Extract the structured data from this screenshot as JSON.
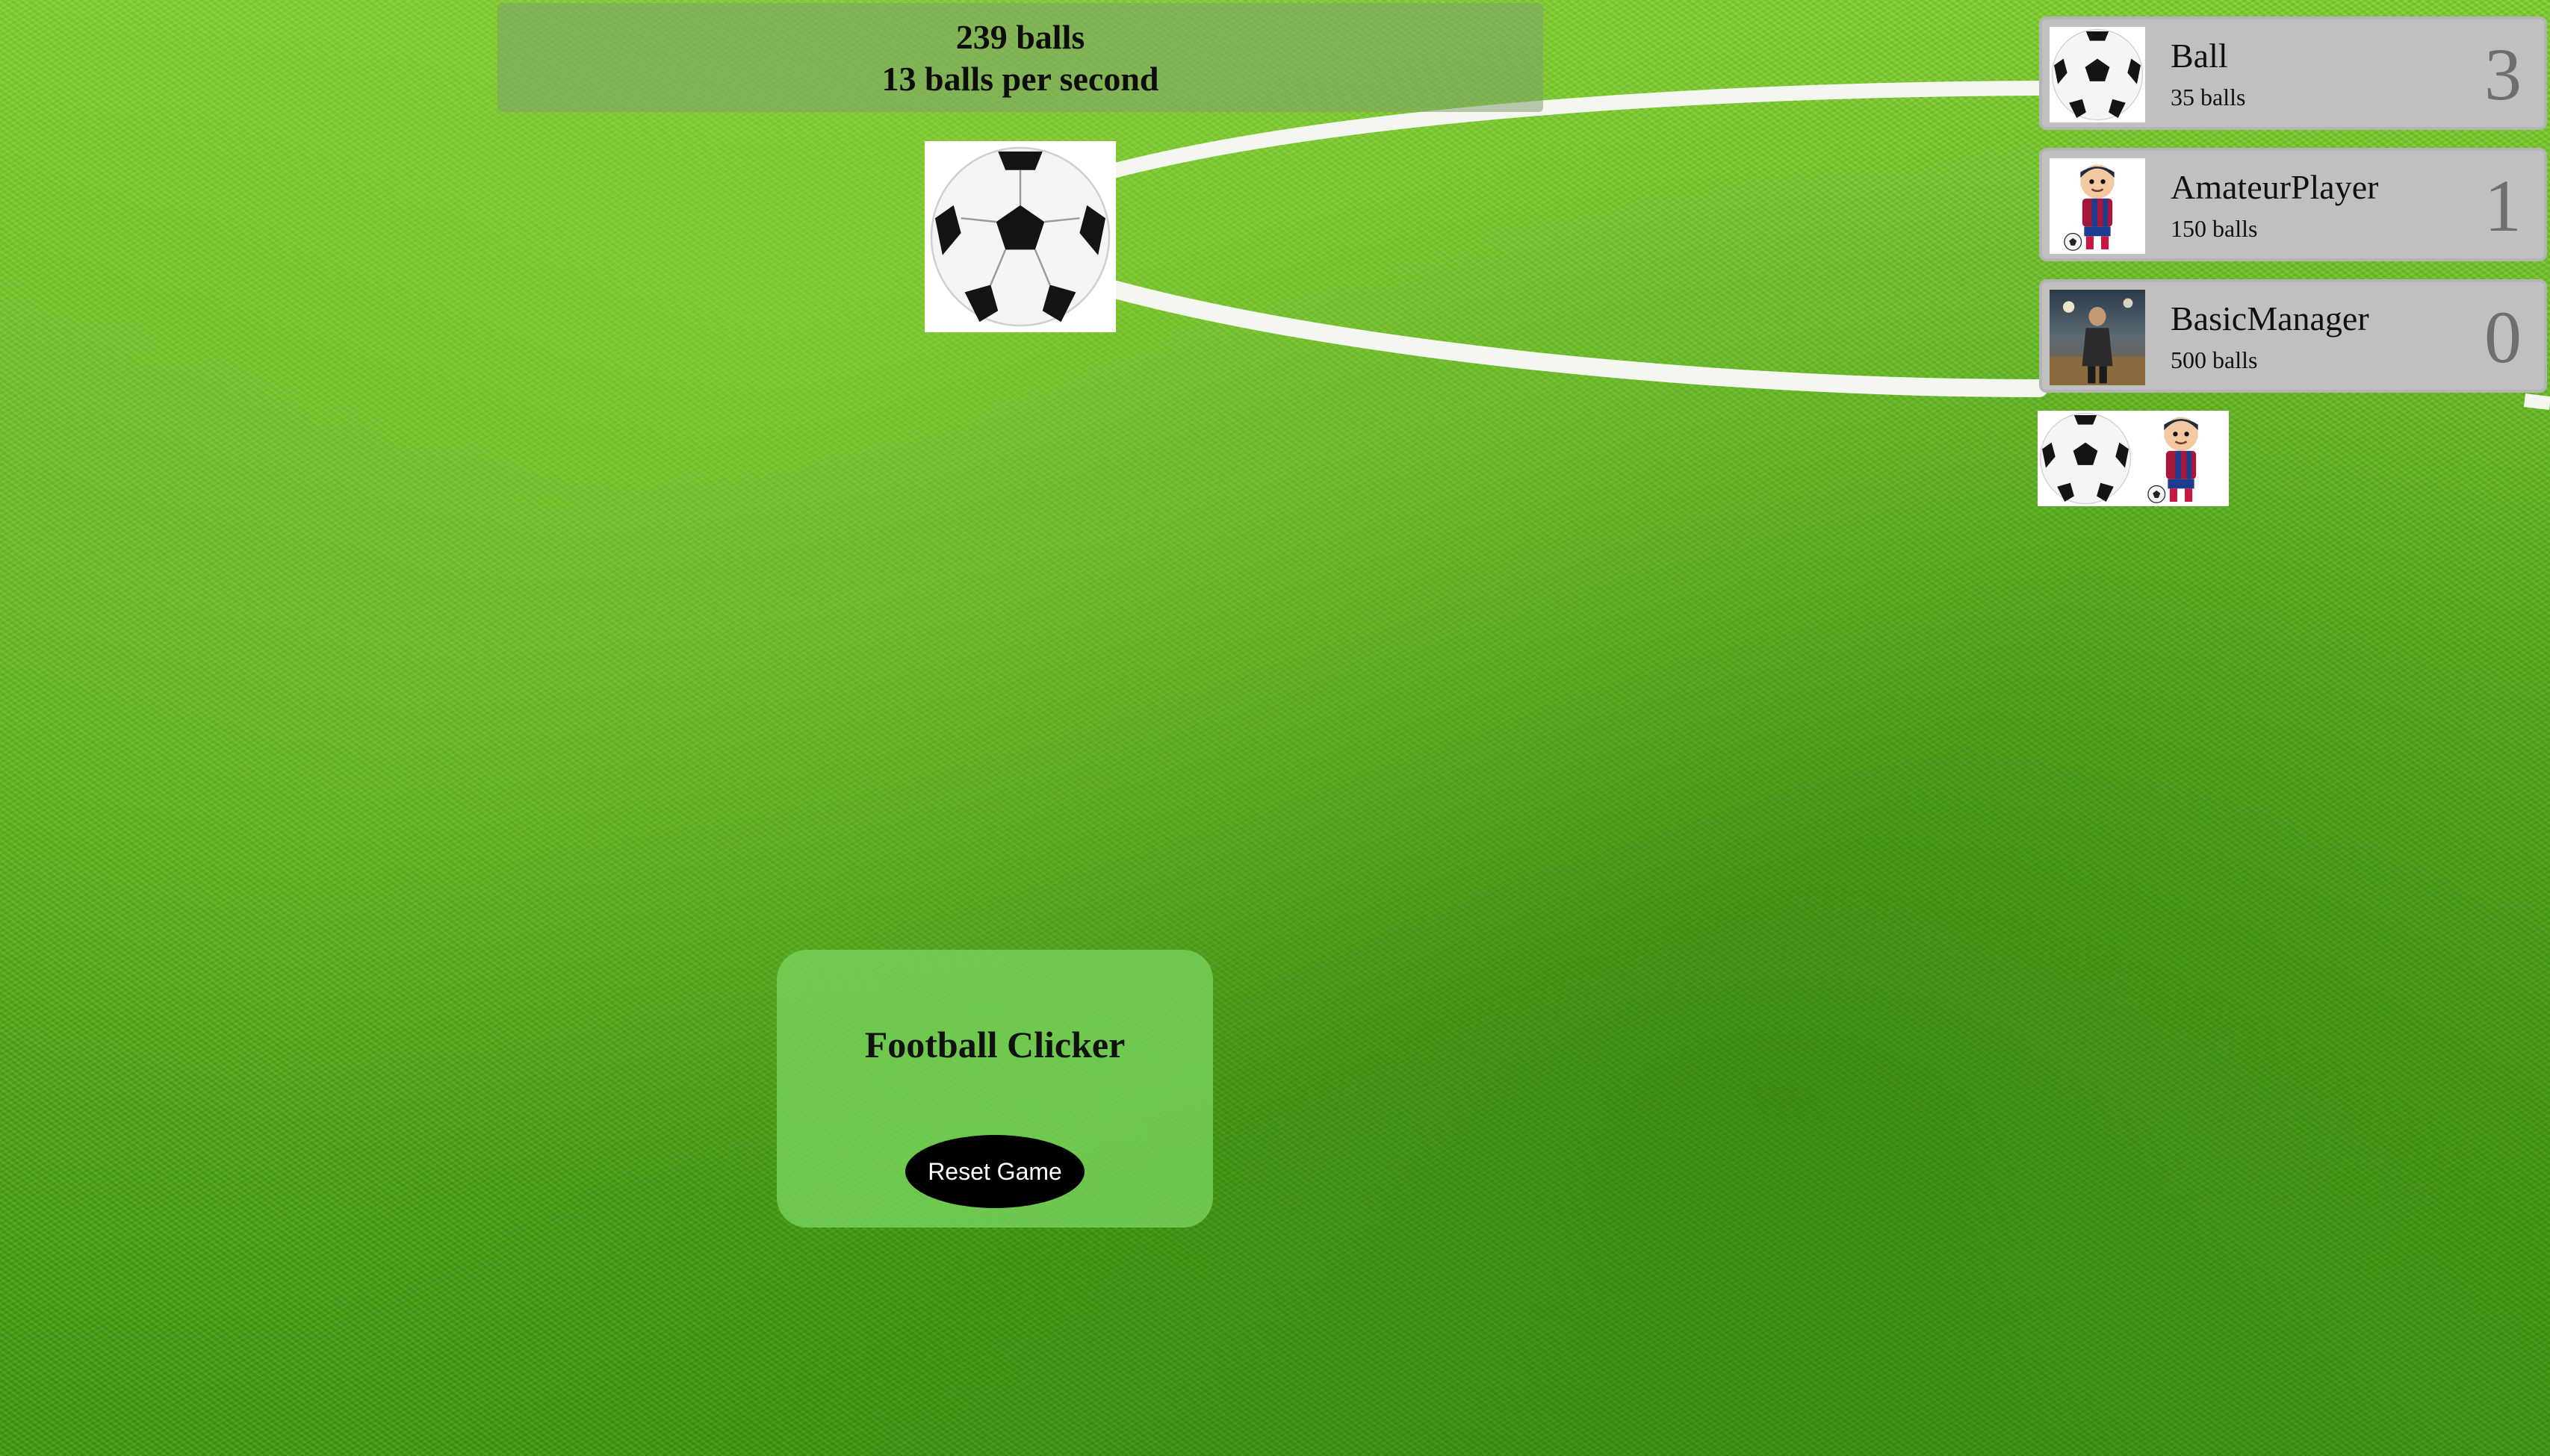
{
  "game": {
    "balls_text": "239 balls",
    "rate_text": "13 balls per second",
    "title": "Football Clicker",
    "reset_label": "Reset Game",
    "main_clicker_icon": "soccer-ball"
  },
  "upgrades": [
    {
      "name": "Ball",
      "cost": "35 balls",
      "count": "3",
      "icon": "soccer-ball"
    },
    {
      "name": "AmateurPlayer",
      "cost": "150 balls",
      "count": "1",
      "icon": "cartoon-player"
    },
    {
      "name": "BasicManager",
      "cost": "500 balls",
      "count": "0",
      "icon": "manager-photo"
    }
  ],
  "owned": [
    "soccer-ball",
    "cartoon-player"
  ],
  "colors": {
    "grass": "#5cb51c",
    "panel": "#c0c0c0",
    "title_card": "#78d25a",
    "button": "#000000"
  }
}
